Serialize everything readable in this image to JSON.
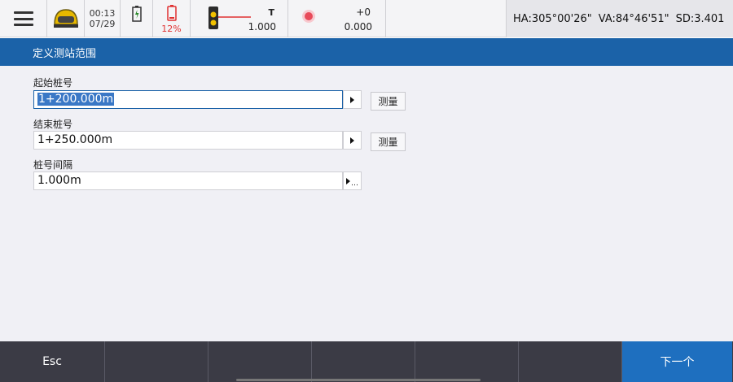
{
  "status": {
    "date_time": {
      "time": "00:13",
      "date": "07/29"
    },
    "battery2_percent": "12%",
    "target": {
      "type": "T",
      "height": "1.000"
    },
    "laser": {
      "offset": "+0",
      "value": "0.000"
    },
    "angles": {
      "ha": "HA:305°00'26\"",
      "va": "VA:84°46'51\"",
      "sd": "SD:3.401"
    }
  },
  "title": "定义测站范围",
  "fields": {
    "start": {
      "label": "起始桩号",
      "value": "1+200.000m"
    },
    "end": {
      "label": "结束桩号",
      "value": "1+250.000m"
    },
    "interval": {
      "label": "桩号间隔",
      "value": "1.000m"
    }
  },
  "buttons": {
    "measure": "测量",
    "esc": "Esc",
    "next": "下一个"
  },
  "colors": {
    "accent": "#1b62a8",
    "bottom_bar": "#3b3b45",
    "next_button": "#1e6fbf",
    "battery_low": "#e03030"
  },
  "icons": [
    "menu-icon",
    "instrument-icon",
    "battery-icon",
    "battery-low-icon",
    "prism-target-icon",
    "laser-icon",
    "arrow-right-icon",
    "more-icon"
  ]
}
